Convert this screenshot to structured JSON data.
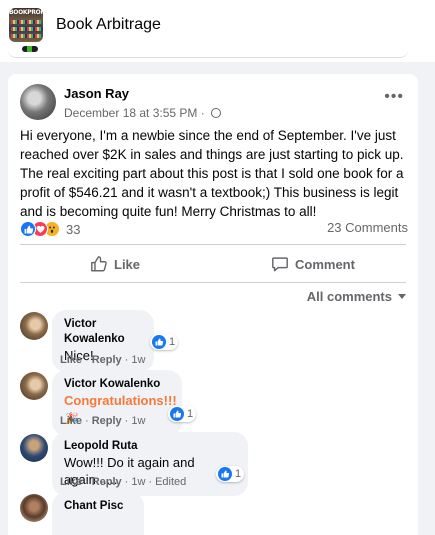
{
  "group": {
    "name": "Book Arbitrage",
    "logo_text": "BOOKPROFIT"
  },
  "post": {
    "author": "Jason Ray",
    "timestamp": "December 18 at 3:55 PM",
    "separator": "·",
    "more_label": "•••",
    "body": "Hi everyone, I'm a newbie since the end of September.  I've just reached over $2K in sales and things are just starting to pick up.  The real exciting part about this post is that I sold one book for a profit of $546.21 and it wasn't a textbook;)  This business is legit and is becoming quite fun!  Merry Christmas to all!",
    "reaction_count": "33",
    "comments_count": "23 Comments",
    "reaction_icons": [
      "like-icon",
      "love-icon",
      "wow-icon"
    ]
  },
  "actions": {
    "like": "Like",
    "comment": "Comment"
  },
  "comments_filter": "All comments",
  "comments": [
    {
      "name": "Victor Kowalenko",
      "text": "Nice!",
      "reacts": "1",
      "like": "Like",
      "reply": "Reply",
      "time": "1w"
    },
    {
      "name": "Victor Kowalenko",
      "text": "Congratulations!!!",
      "reacts": "1",
      "like": "Like",
      "reply": "Reply",
      "time": "1w"
    },
    {
      "name": "Leopold Ruta",
      "text": "Wow!!! Do it again and again......",
      "reacts": "1",
      "like": "Like",
      "reply": "Reply",
      "time": "1w",
      "edited": "Edited"
    },
    {
      "name": "Chant Pisc"
    }
  ],
  "colors": {
    "brand": "#1877f2",
    "congrats": "#f5793b",
    "love": "#f33e58",
    "wow": "#f7b125"
  }
}
